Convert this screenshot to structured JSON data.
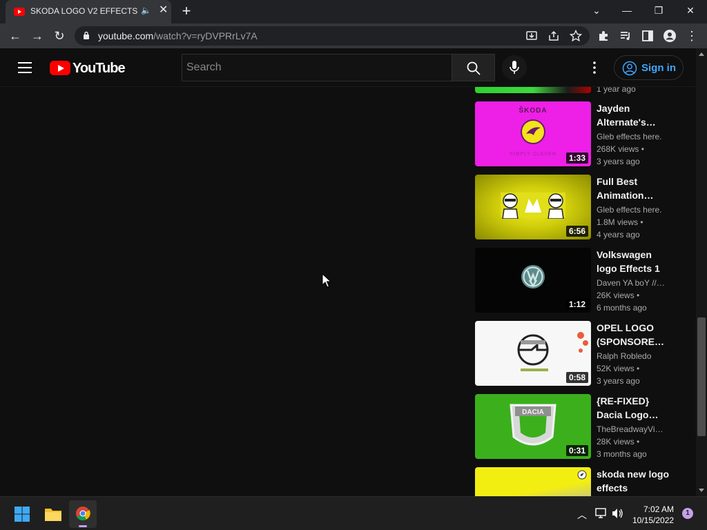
{
  "browser": {
    "tab_title": "SKODA LOGO V2 EFFECTS S",
    "url_host": "youtube.com",
    "url_path": "/watch?v=ryDVPRrLv7A"
  },
  "youtube": {
    "logo_text": "YouTube",
    "search_placeholder": "Search",
    "signin_label": "Sign in"
  },
  "partial_top": {
    "age": "1 year ago"
  },
  "recommendations": [
    {
      "title1": "Jayden",
      "title2": "Alternate's…",
      "channel": "Gleb effects here.",
      "views": "268K views •",
      "age": "3 years ago",
      "duration": "1:33",
      "thumb": "skoda-magenta"
    },
    {
      "title1": "Full Best",
      "title2": "Animation…",
      "channel": "Gleb effects here.",
      "views": "1.8M views •",
      "age": "4 years ago",
      "duration": "6:56",
      "thumb": "kfc-yellow"
    },
    {
      "title1": "Volkswagen",
      "title2": "logo Effects 1",
      "channel": "Daven YA boY // …",
      "views": "26K views •",
      "age": "6 months ago",
      "duration": "1:12",
      "thumb": "vw-dark"
    },
    {
      "title1": "OPEL LOGO",
      "title2": "(SPONSORED…",
      "channel": "Ralph Robledo",
      "views": "52K views •",
      "age": "3 years ago",
      "duration": "0:58",
      "thumb": "opel-white"
    },
    {
      "title1": "{RE-FIXED}",
      "title2": "Dacia Logo…",
      "channel": "TheBreadwayVid…",
      "views": "28K views •",
      "age": "3 months ago",
      "duration": "0:31",
      "thumb": "dacia-green"
    },
    {
      "title1": "skoda new logo",
      "title2": "effects",
      "channel": "",
      "views": "",
      "age": "",
      "duration": "",
      "thumb": "skoda-yellow"
    }
  ],
  "thumb_text": {
    "skoda_brand": "ŠKODA",
    "skoda_slogan": "SIMPLY CLEVER",
    "dacia_brand": "DACIA"
  },
  "taskbar": {
    "time": "7:02 AM",
    "date": "10/15/2022",
    "notifications": "1"
  },
  "colors": {
    "youtube_red": "#ff0000",
    "signin_blue": "#3ea6ff",
    "page_bg": "#0f0f0f"
  }
}
